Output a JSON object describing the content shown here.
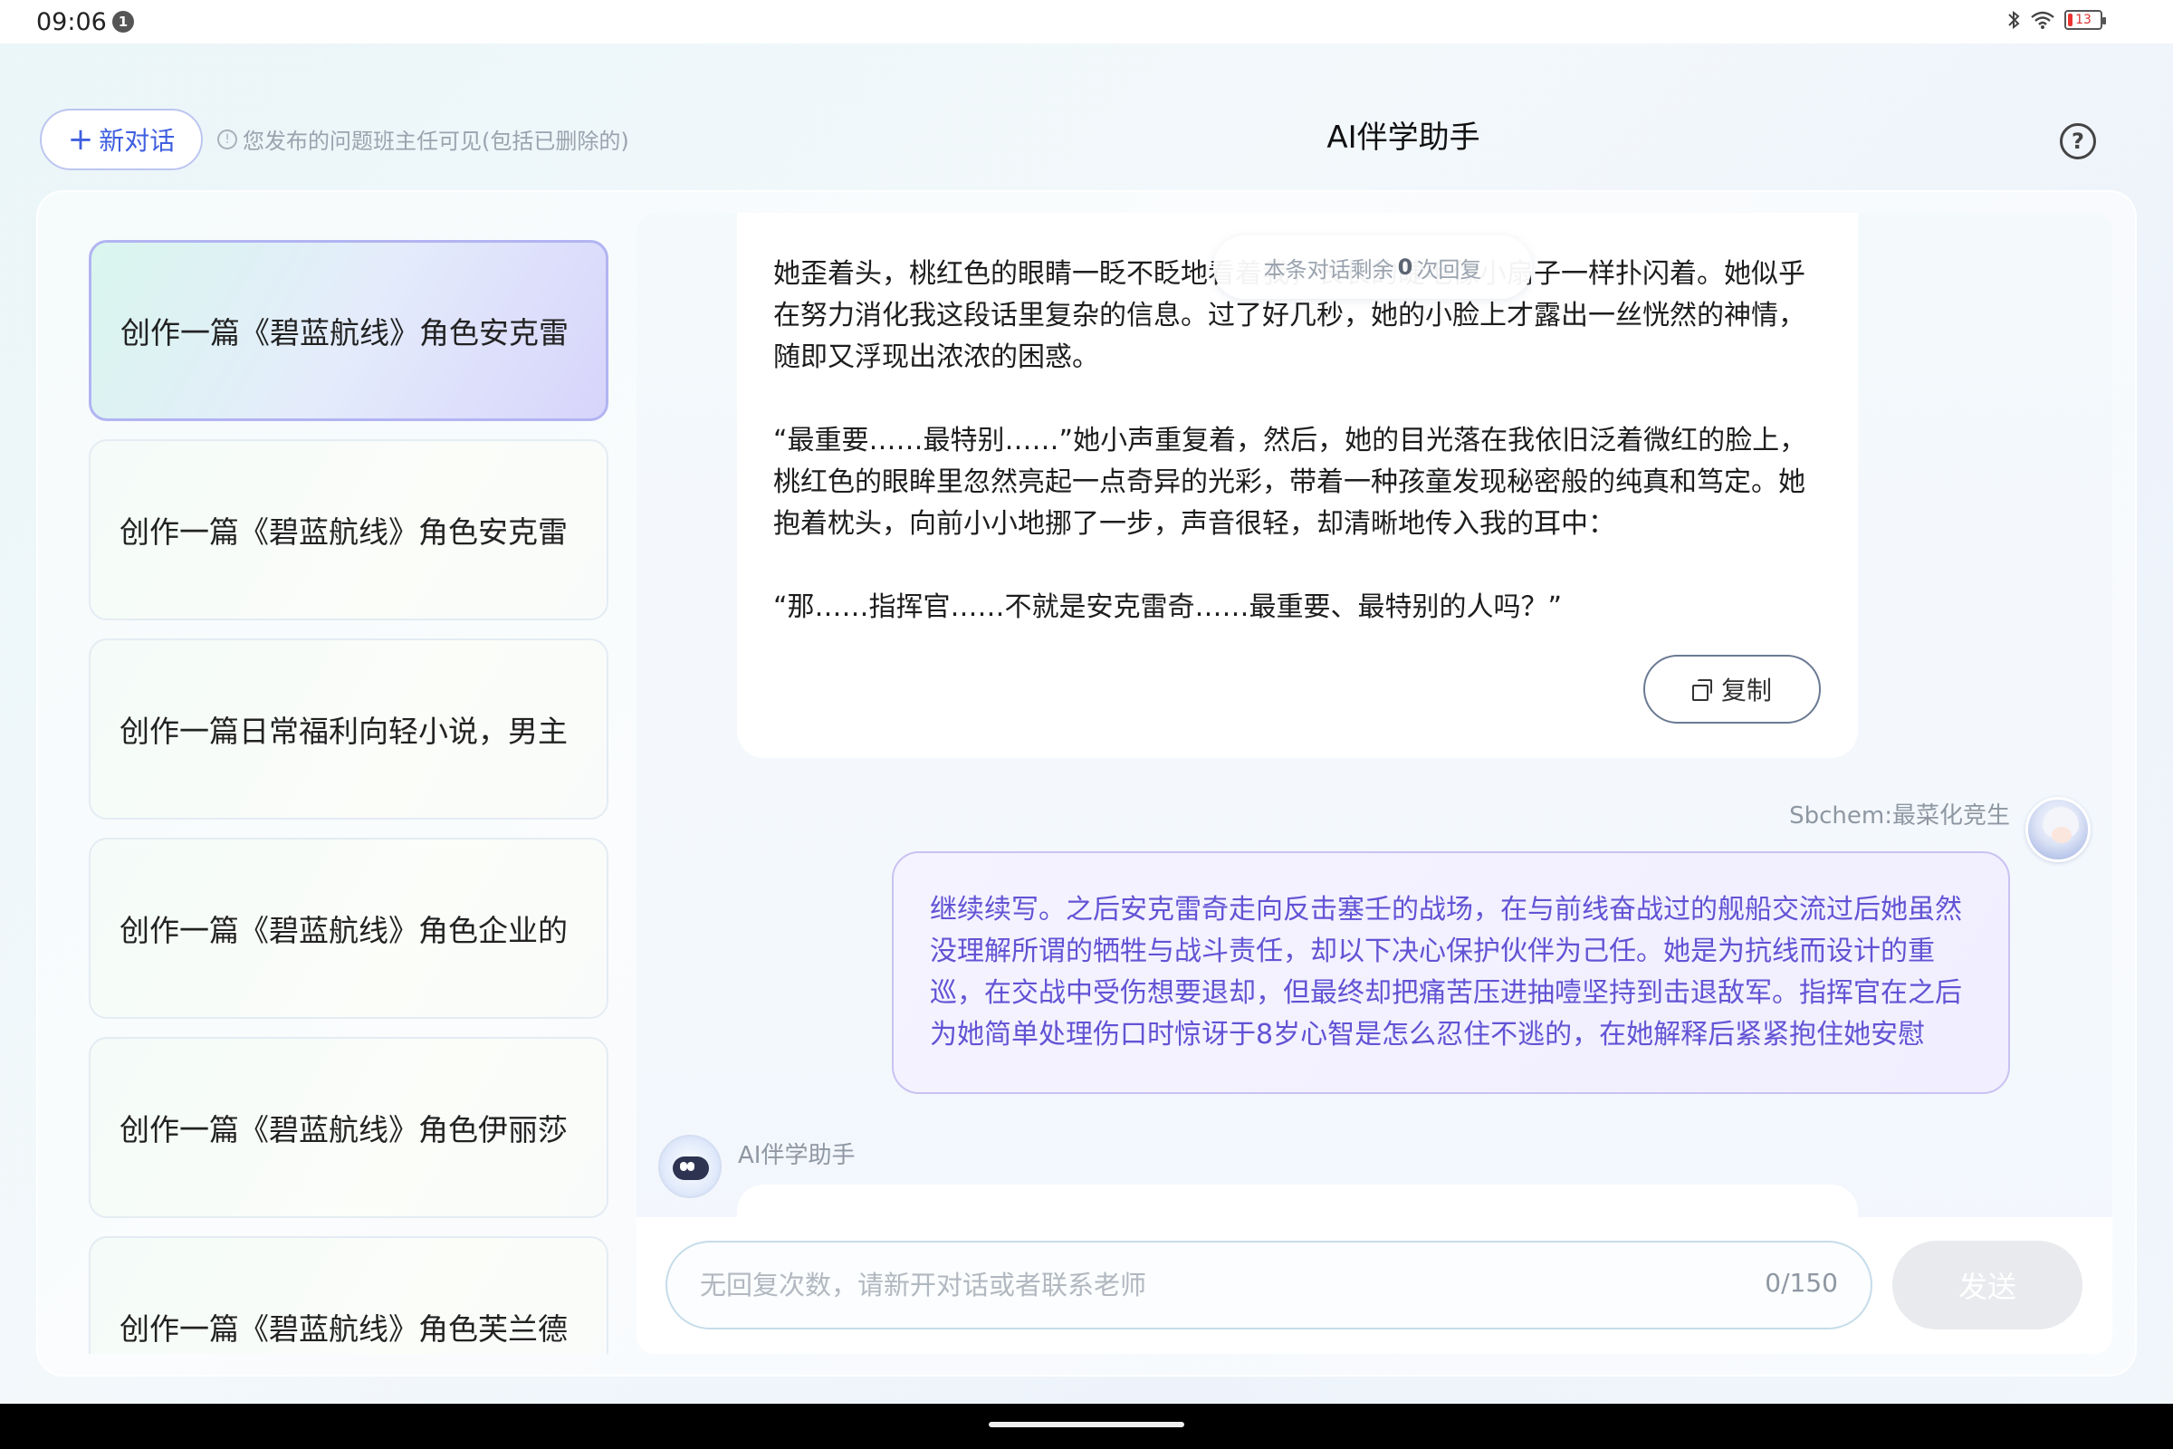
{
  "status_bar": {
    "time": "09:06",
    "notification_count": "1",
    "battery_level": "13",
    "icons": [
      "bluetooth-icon",
      "wifi-icon",
      "battery-icon"
    ]
  },
  "header": {
    "new_chat_label": "新对话",
    "new_chat_icon": "plus-icon",
    "notice": "您发布的问题班主任可见(包括已删除的)",
    "title": "AI伴学助手",
    "help_icon": "help-icon"
  },
  "sidebar": {
    "items": [
      {
        "label": "创作一篇《碧蓝航线》角色安克雷",
        "active": true
      },
      {
        "label": "创作一篇《碧蓝航线》角色安克雷",
        "active": false
      },
      {
        "label": "创作一篇日常福利向轻小说，男主",
        "active": false
      },
      {
        "label": "创作一篇《碧蓝航线》角色企业的",
        "active": false
      },
      {
        "label": "创作一篇《碧蓝航线》角色伊丽莎",
        "active": false
      },
      {
        "label": "创作一篇《碧蓝航线》角色芙兰德",
        "active": false
      }
    ]
  },
  "chat": {
    "remaining_prefix": "本条对话剩余",
    "remaining_count": "0",
    "remaining_suffix": "次回复",
    "ai_message": "她歪着头，桃红色的眼睛一眨不眨地看着我，长长的睫毛像小扇子一样扑闪着。她似乎在努力消化我这段话里复杂的信息。过了好几秒，她的小脸上才露出一丝恍然的神情，随即又浮现出浓浓的困惑。\n\n“最重要……最特别……”她小声重复着，然后，她的目光落在我依旧泛着微红的脸上，桃红色的眼眸里忽然亮起一点奇异的光彩，带着一种孩童发现秘密般的纯真和笃定。她抱着枕头，向前小小地挪了一步，声音很轻，却清晰地传入我的耳中：\n\n“那……指挥官……不就是安克雷奇……最重要、最特别的人吗？”",
    "copy_label": "复制",
    "copy_icon": "copy-icon",
    "user_name": "Sbchem:最菜化竞生",
    "user_message": "继续续写。之后安克雷奇走向反击塞壬的战场，在与前线奋战过的舰船交流过后她虽然没理解所谓的牺牲与战斗责任，却以下决心保护伙伴为己任。她是为抗线而设计的重巡，在交战中受伤想要退却，但最终却把痛苦压进抽噎坚持到击退敌军。指挥官在之后为她简单处理伤口时惊讶于8岁心智是怎么忍住不逃的，在她解释后紧紧抱住她安慰",
    "ai_name": "AI伴学助手"
  },
  "input": {
    "placeholder": "无回复次数，请新开对话或者联系老师",
    "value": "",
    "char_count": "0/150",
    "send_label": "发送"
  },
  "colors": {
    "accent": "#3f5fe0",
    "user_bubble_text": "#6253d4",
    "active_item_border": "#b2b4f2"
  }
}
